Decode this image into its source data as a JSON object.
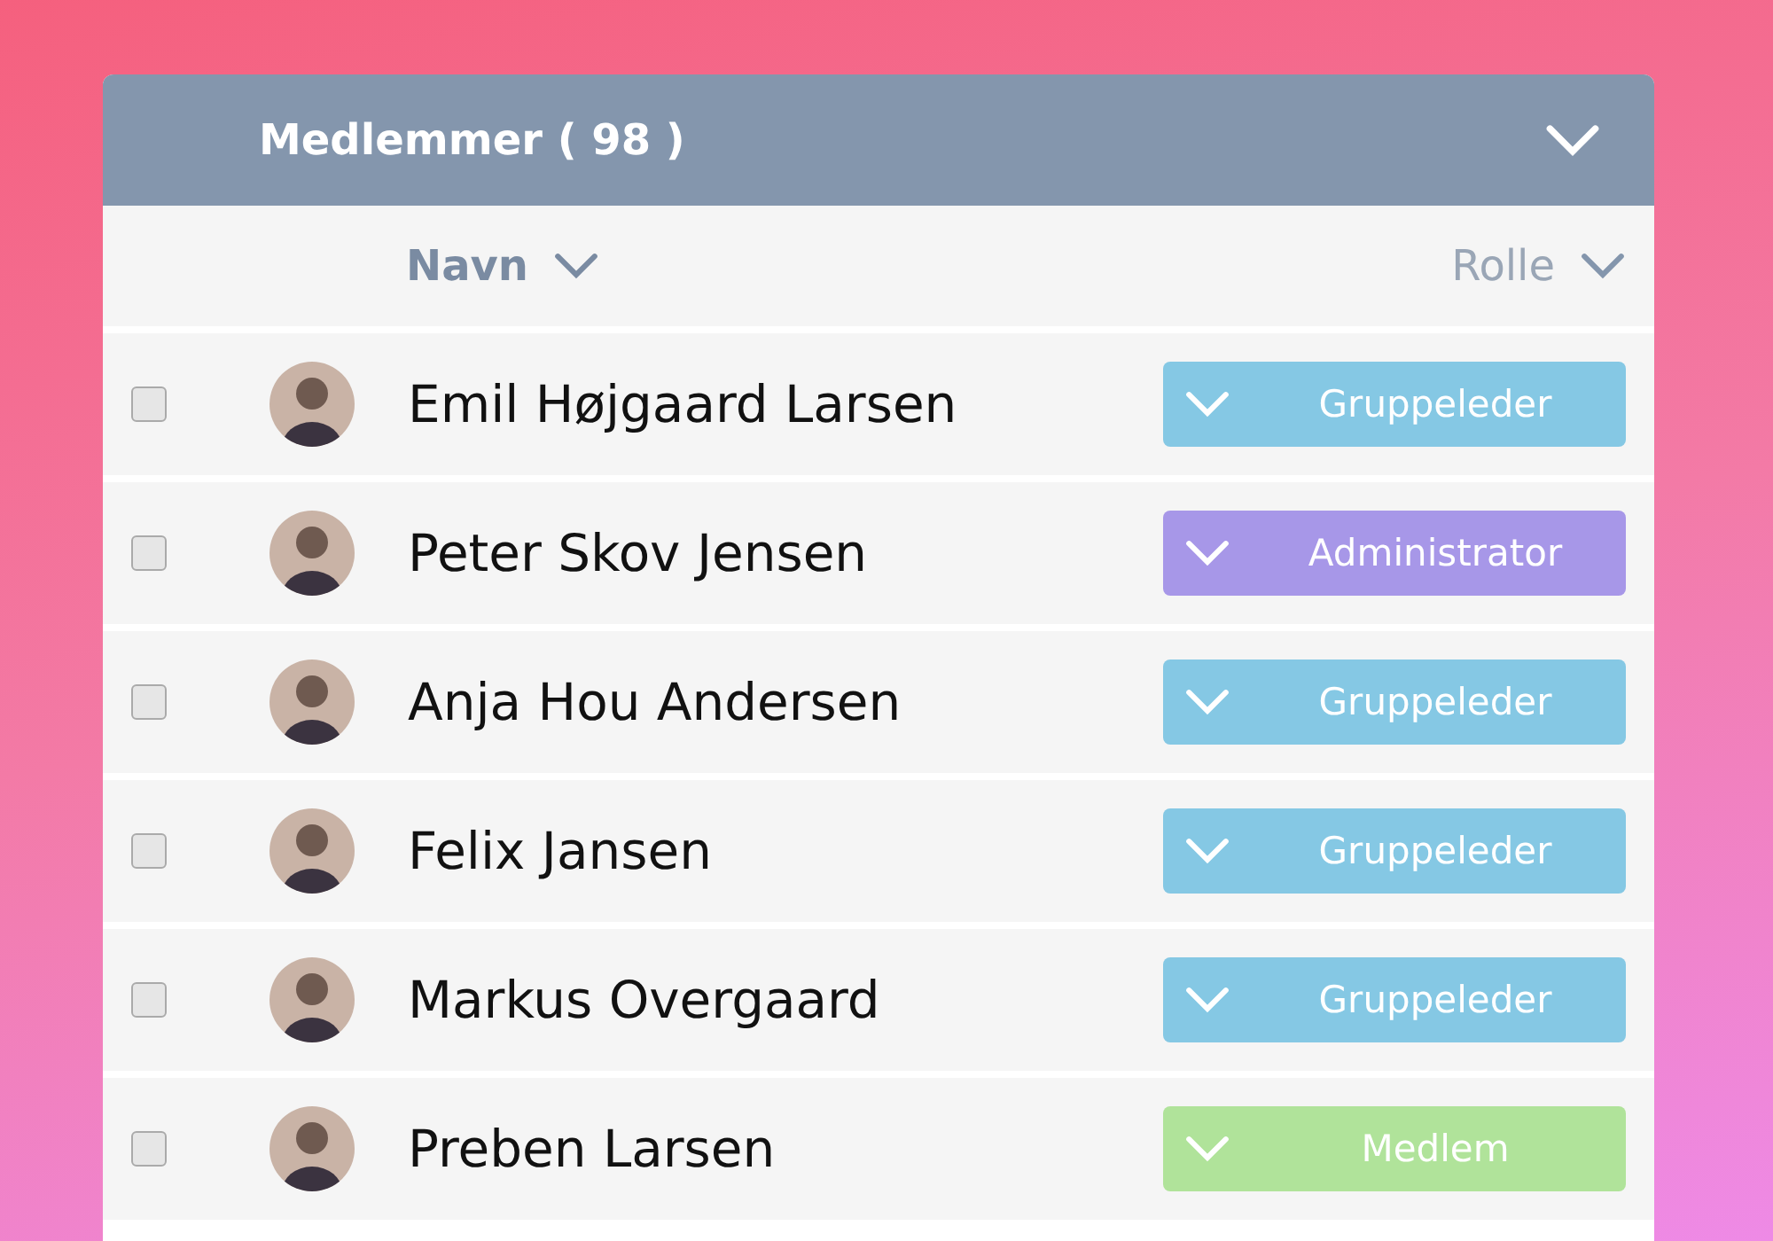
{
  "panel": {
    "title": "Medlemmer ( 98 )",
    "expanded": true
  },
  "columns": [
    {
      "label": "Navn",
      "kind": "name"
    },
    {
      "label": "Rolle",
      "kind": "role"
    }
  ],
  "members": [
    {
      "name": "Emil Højgaard Larsen",
      "checked": false,
      "role": "Gruppeleder",
      "color": "#85c8e4"
    },
    {
      "name": "Peter Skov Jensen",
      "checked": false,
      "role": "Administrator",
      "color": "#a797e8"
    },
    {
      "name": "Anja Hou Andersen",
      "checked": false,
      "role": "Gruppeleder",
      "color": "#85c8e4"
    },
    {
      "name": "Felix Jansen",
      "checked": false,
      "role": "Gruppeleder",
      "color": "#85c8e4"
    },
    {
      "name": "Markus Overgaard",
      "checked": false,
      "role": "Gruppeleder",
      "color": "#85c8e4"
    },
    {
      "name": "Preben Larsen",
      "checked": false,
      "role": "Medlem",
      "color": "#b0e39a"
    }
  ]
}
